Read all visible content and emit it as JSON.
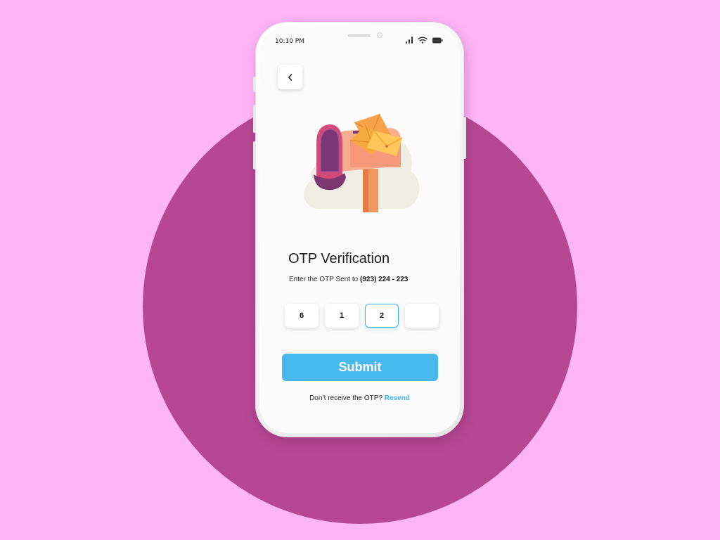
{
  "status_bar": {
    "time": "10:10 PM"
  },
  "header": {
    "back_icon": "chevron-left-icon"
  },
  "main": {
    "title": "OTP Verification",
    "subtitle_prefix": "Enter the OTP Sent to ",
    "phone_number": "(923) 224 - 223",
    "otp_digits": [
      "6",
      "1",
      "2",
      ""
    ],
    "active_index": 2
  },
  "actions": {
    "submit_label": "Submit",
    "resend_prompt": "Don’t receive the OTP? ",
    "resend_label": "Resend"
  },
  "colors": {
    "page_background": "#fdb5f7",
    "circle": "#b64893",
    "accent": "#47b9ec",
    "screen": "#fbfbfb"
  }
}
